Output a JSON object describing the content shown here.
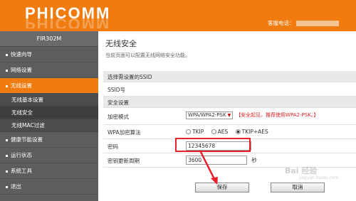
{
  "header": {
    "logo": "PHICOMM",
    "hotline_label": "客服电话："
  },
  "sidebar": {
    "model": "FIR302M",
    "items": [
      {
        "label": "快速向导"
      },
      {
        "label": "网络设置"
      },
      {
        "label": "无线设置",
        "active": true
      },
      {
        "label": "健康节能设置"
      },
      {
        "label": "运行状态"
      },
      {
        "label": "系统工具"
      },
      {
        "label": "退出"
      }
    ],
    "subitems": [
      "无线基本设置",
      "无线安全",
      "无线MAC过滤"
    ]
  },
  "main": {
    "title": "无线安全",
    "description": "当前页面可以配置无线网络安全功能。",
    "section_ssid": "选择需设置的SSID",
    "ssid_label": "SSID号",
    "section_security": "安全设置",
    "encryption_label": "加密模式",
    "encryption_value": "WPA/WPA2-PSK",
    "encryption_note": "【安全起见，推荐使用WPA2-PSK。】",
    "algorithm_label": "WPA加密算法",
    "algorithm_options": [
      "TKIP",
      "AES",
      "TKIP+AES"
    ],
    "algorithm_selected": "TKIP+AES",
    "password_label": "密码",
    "password_value": "12345678",
    "rekey_label": "密钥更新周期",
    "rekey_value": "3600",
    "rekey_unit": "秒",
    "save_label": "保存",
    "cancel_label": "取消"
  },
  "watermark": "Bai 经验",
  "watermark_sub": "jingyan.baidu.com",
  "colors": {
    "brand_orange": "#f07c10",
    "sidebar_gray": "#5d5d5d",
    "highlight_red": "#e8202a",
    "warning_red": "#e02020"
  }
}
